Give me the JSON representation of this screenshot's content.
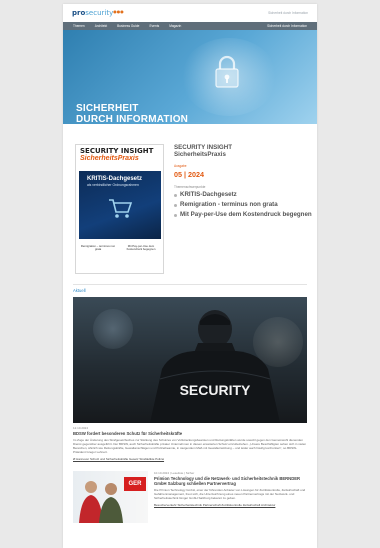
{
  "header": {
    "logo_pro": "pro",
    "logo_security": "security",
    "top_right": "Sicherheit durch Information"
  },
  "nav": {
    "items": [
      "Themen",
      "Architekt",
      "Business Guide",
      "Events",
      "Magazin"
    ],
    "cta": "Sicherheit durch Information"
  },
  "hero": {
    "line1": "SICHERHEIT",
    "line2": "DURCH INFORMATION"
  },
  "magazine": {
    "cover_brand": "SECURITY INSIGHT",
    "cover_sub": "SicherheitsPraxis",
    "cover_headline": "KRITIS-Dachgesetz",
    "cover_headline_sub": "als verbindlicher Ordnungsrahmen",
    "cover_foot_left": "Remigration – terminus non grata",
    "cover_foot_right": "Mit Pay-per-Use dem Kostendruck begegnen",
    "title_line1": "SECURITY INSIGHT",
    "title_line2": "SicherheitsPraxis",
    "issue_label": "Ausgabe",
    "issue": "05 | 2024",
    "topics_label": "Themenschwerpunkte",
    "topics": [
      "KRITIS-Dachgesetz",
      "Remigration - terminus non grata",
      "Mit Pay-per-Use dem Kostendruck begegnen"
    ]
  },
  "feed": {
    "section_label": "Aktuell",
    "article1": {
      "image_text": "SECURITY",
      "date": "12.10.2024",
      "title": "BDSW fordert besonderen Schutz für Sicherheitskräfte",
      "body": "Im Zuge der Änderung des Strafgesetzbuches zur Stärkung des Schutzes von Vollstreckungsbeamten und Rettungskräften wurde sowohl gegen den Gemeinwohl dienenden Dienst gegenüber ausgeführt. Der BDSW, auch Sicherheitskräfte privater Unternehmen in diesen erweiterten Schutz einzubeziehen. „Unsere Beschäftigten sehen sich in vielen Bereichen, ähnlich wie Rettungskräfte, Gewaltanschlägen und Polizeibeamte, in steigendem Maß mit Gewalteinwirkung – und leider auch häufig konfrontiert“, so BDSW-Präsident Gregor Lehnert.",
      "tags": "Ø Hannover Schutz und Sicherheitskräfte Gesetz Strafdelikte Polizei"
    },
    "article2": {
      "meta": "10.10.2024 | Leseliste | Sicher",
      "title": "Primion Technology und die Netzwerk- und Sicherheitstechnik BERNDER GmbH Salzburg schließen Partnervertrag",
      "body": "Die Primion Technology GmbH, einer der führenden Anbieter von Lösungen für Zutrittskontrolle, Zeitwirtschaft und Gefahrenmanagement, freut sich, die Unterzeichnung eines neuen Partnervertrags mit der Netzwerk- und Sicherheitstechnik Ginger GmbH Salzburg bekannt zu geben.",
      "tags": "Besucherverkehr Sicherheitstechnik Partnerschaft Zutrittskontrolle Zeitwirtschaft Architektur",
      "thumb_logo": "GER"
    }
  }
}
